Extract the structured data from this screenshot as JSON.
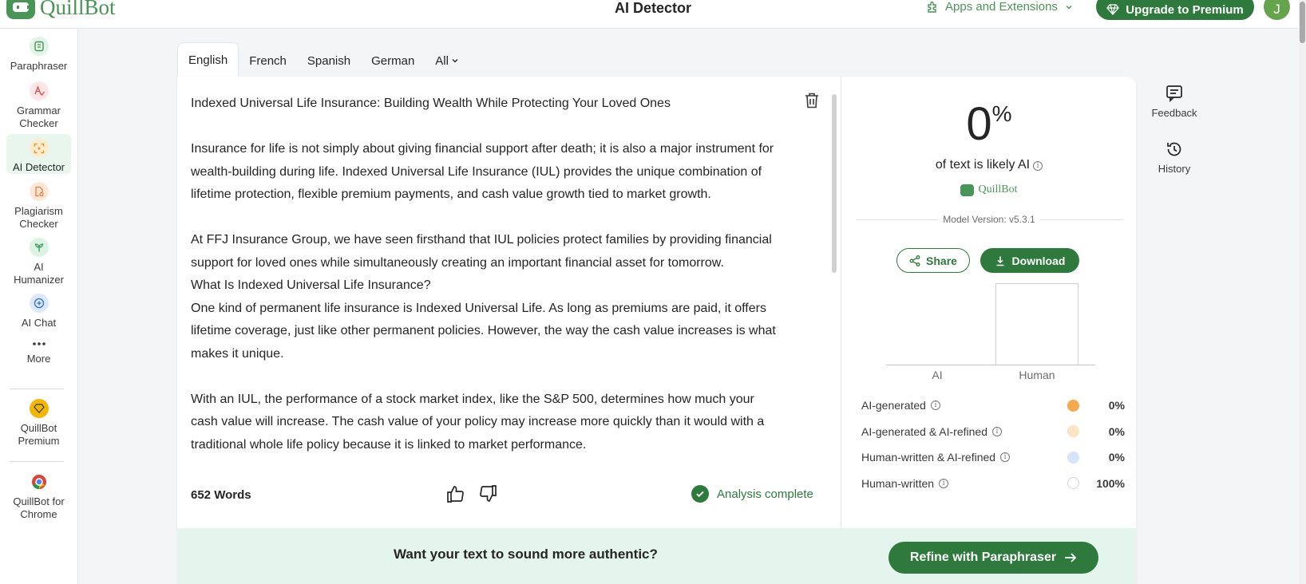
{
  "header": {
    "brand": "QuillBot",
    "title": "AI Detector",
    "apps_label": "Apps and Extensions",
    "upgrade_label": "Upgrade to Premium",
    "avatar_initial": "J"
  },
  "sidebar": {
    "items": [
      {
        "label": "Paraphraser",
        "icon": "paraphraser-icon"
      },
      {
        "label": "Grammar Checker",
        "icon": "grammar-icon"
      },
      {
        "label": "AI Detector",
        "icon": "ai-detector-icon"
      },
      {
        "label": "Plagiarism Checker",
        "icon": "plagiarism-icon"
      },
      {
        "label": "AI Humanizer",
        "icon": "humanizer-icon"
      },
      {
        "label": "AI Chat",
        "icon": "chat-icon"
      },
      {
        "label": "More",
        "icon": "more-icon"
      },
      {
        "label": "QuillBot Premium",
        "icon": "premium-icon"
      },
      {
        "label": "QuillBot for Chrome",
        "icon": "chrome-icon"
      }
    ]
  },
  "tabs": [
    "English",
    "French",
    "Spanish",
    "German",
    "All"
  ],
  "editor": {
    "title_line": "Indexed Universal Life Insurance: Building Wealth While Protecting Your Loved Ones",
    "p1": "Insurance for life is not simply about giving financial support after death; it is also a major instrument for wealth-building during life. Indexed Universal Life Insurance (IUL) provides the unique combination of lifetime protection, flexible premium payments, and cash value growth tied to market growth.",
    "p2": "At FFJ Insurance Group, we have seen firsthand that IUL policies protect families by providing financial support for loved ones while simultaneously creating an important financial asset for tomorrow.",
    "p3": "What Is Indexed Universal Life Insurance?",
    "p4": "One kind of permanent life insurance is Indexed Universal Life. As long as premiums are paid, it offers lifetime coverage, just like other permanent policies. However, the way the cash value increases is what makes it unique.",
    "p5": "With an IUL, the performance of a stock market index, like the S&P 500, determines how much your cash value will increase. The cash value of your policy may increase more quickly than it would with a traditional whole life policy because it is linked to market performance.",
    "word_count": "652 Words",
    "status": "Analysis complete"
  },
  "results": {
    "percent": "0",
    "percent_sign": "%",
    "likely_label": "of text is likely AI",
    "brand": "QuillBot",
    "model_version": "Model Version: v5.3.1",
    "share_label": "Share",
    "download_label": "Download",
    "chart_data": {
      "type": "bar",
      "categories": [
        "AI",
        "Human"
      ],
      "values": [
        0,
        100
      ],
      "ylim": [
        0,
        100
      ]
    },
    "legend": [
      {
        "label": "AI-generated",
        "value": "0%",
        "color": "#f5a94b"
      },
      {
        "label": "AI-generated & AI-refined",
        "value": "0%",
        "color": "#fbe3c4"
      },
      {
        "label": "Human-written & AI-refined",
        "value": "0%",
        "color": "#d5e4f8"
      },
      {
        "label": "Human-written",
        "value": "100%",
        "color": "#ffffff"
      }
    ]
  },
  "banner": {
    "text": "Want your text to sound more authentic?",
    "button": "Refine with Paraphraser"
  },
  "utilities": {
    "feedback": "Feedback",
    "history": "History"
  },
  "colors": {
    "brand": "#499557",
    "primary": "#2d7a3c",
    "banner_bg": "#e3f5ec"
  }
}
